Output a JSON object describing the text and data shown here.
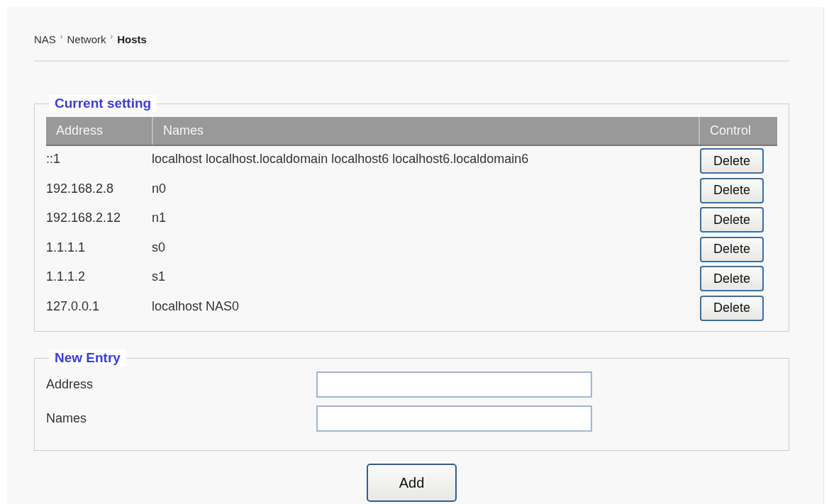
{
  "breadcrumb": {
    "items": [
      {
        "label": "NAS",
        "current": false
      },
      {
        "label": "Network",
        "current": false
      },
      {
        "label": "Hosts",
        "current": true
      }
    ],
    "separator": "›"
  },
  "current_setting": {
    "legend": "Current setting",
    "columns": [
      "Address",
      "Names",
      "Control"
    ],
    "rows": [
      {
        "address": "::1",
        "names": "localhost localhost.localdomain localhost6 localhost6.localdomain6",
        "action": "Delete"
      },
      {
        "address": "192.168.2.8",
        "names": "n0",
        "action": "Delete"
      },
      {
        "address": "192.168.2.12",
        "names": "n1",
        "action": "Delete"
      },
      {
        "address": "1.1.1.1",
        "names": "s0",
        "action": "Delete"
      },
      {
        "address": "1.1.1.2",
        "names": "s1",
        "action": "Delete"
      },
      {
        "address": "127.0.0.1",
        "names": "localhost NAS0",
        "action": "Delete"
      }
    ]
  },
  "new_entry": {
    "legend": "New Entry",
    "fields": [
      {
        "label": "Address"
      },
      {
        "label": "Names"
      }
    ]
  },
  "add_button": "Add"
}
